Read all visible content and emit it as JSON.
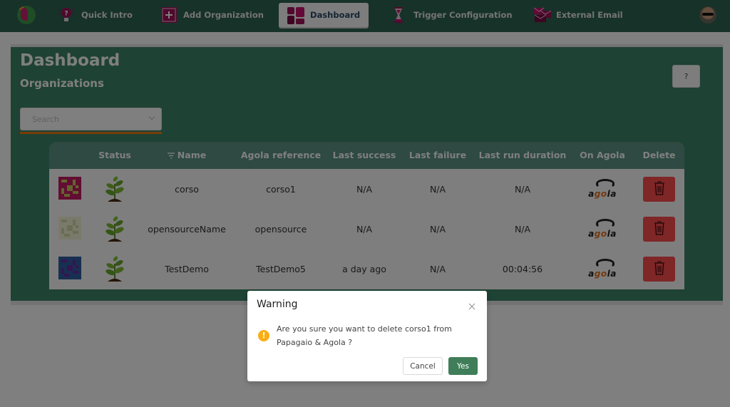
{
  "navbar": {
    "logo_icon": "parrot-logo-icon",
    "items": [
      {
        "label": "Quick Intro",
        "icon": "lightbulb-question-icon",
        "active": false
      },
      {
        "label": "Add Organization",
        "icon": "plus-square-icon",
        "active": false
      },
      {
        "label": "Dashboard",
        "icon": "dashboard-grid-icon",
        "active": true
      },
      {
        "label": "Trigger Configuration",
        "icon": "hourglass-icon",
        "active": false
      },
      {
        "label": "External Email",
        "icon": "envelopes-icon",
        "active": false
      }
    ],
    "user_avatar": "user-avatar"
  },
  "page": {
    "title": "Dashboard",
    "subtitle": "Organizations",
    "help_label": "?",
    "search": {
      "placeholder": "Search",
      "value": ""
    }
  },
  "table": {
    "columns": [
      "",
      "Status",
      "Name",
      "Agola reference",
      "Last success",
      "Last failure",
      "Last run duration",
      "On Agola",
      "Delete"
    ],
    "sortable_column_icon": "filter-sort-icon",
    "rows": [
      {
        "avatar_colors": [
          "#c31d64",
          "#c8c85a"
        ],
        "status_icon": "plant-icon",
        "name": "corso",
        "agola_ref": "corso1",
        "last_success": "N/A",
        "last_failure": "N/A",
        "last_duration": "N/A",
        "on_agola": "agola-logo",
        "delete_icon": "trash-icon"
      },
      {
        "avatar_colors": [
          "#f4f4d8",
          "#d8d8a8"
        ],
        "status_icon": "plant-icon",
        "name": "opensourceName",
        "agola_ref": "opensource",
        "last_success": "N/A",
        "last_failure": "N/A",
        "last_duration": "N/A",
        "on_agola": "agola-logo",
        "delete_icon": "trash-icon"
      },
      {
        "avatar_colors": [
          "#2f5fa0",
          "#6a2aa8"
        ],
        "status_icon": "plant-icon",
        "name": "TestDemo",
        "agola_ref": "TestDemo5",
        "last_success": "a day ago",
        "last_failure": "N/A",
        "last_duration": "00:04:56",
        "on_agola": "agola-logo",
        "delete_icon": "trash-icon"
      }
    ],
    "agola_text": [
      "a",
      "go",
      "la"
    ]
  },
  "modal": {
    "title": "Warning",
    "message": "Are you sure you want to delete corso1 from Papagaio & Agola ?",
    "cancel_label": "Cancel",
    "confirm_label": "Yes",
    "icon": "exclamation-circle-icon"
  },
  "colors": {
    "navbar": "#2e6451",
    "content": "#3c8468",
    "table_header": "#5d9584",
    "accent_orange": "#f07a10",
    "delete_red": "#ff4d4f",
    "confirm_green": "#3f7e58",
    "warning": "#faad14"
  }
}
